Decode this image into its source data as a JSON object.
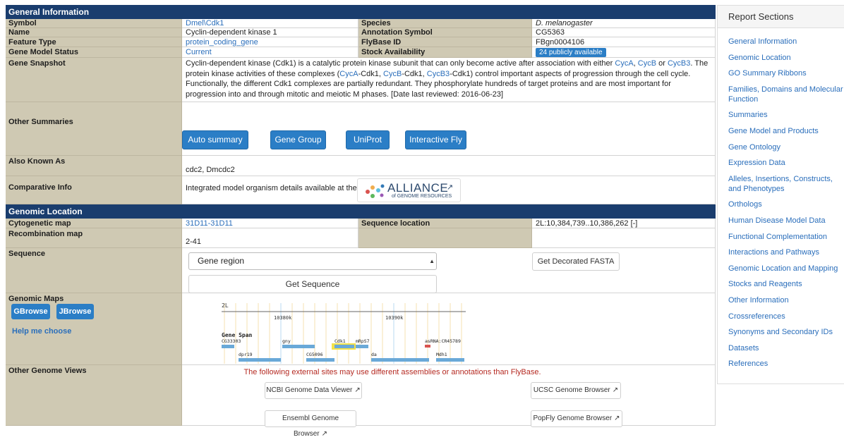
{
  "general": {
    "header": "General Information",
    "symbol_label": "Symbol",
    "symbol_value": "Dmel\\Cdk1",
    "species_label": "Species",
    "species_value": "D. melanogaster",
    "name_label": "Name",
    "name_value": "Cyclin-dependent kinase 1",
    "annot_label": "Annotation Symbol",
    "annot_value": "CG5363",
    "ftype_label": "Feature Type",
    "ftype_value": "protein_coding_gene",
    "fbid_label": "FlyBase ID",
    "fbid_value": "FBgn0004106",
    "gms_label": "Gene Model Status",
    "gms_value": "Current",
    "stock_label": "Stock Availability",
    "stock_badge": "24 publicly available",
    "snapshot_label": "Gene Snapshot",
    "snapshot": {
      "t1": "Cyclin-dependent kinase (Cdk1) is a catalytic protein kinase subunit that can only become active after association with either ",
      "l1": "CycA",
      "t2": ", ",
      "l2": "CycB",
      "t3": " or ",
      "l3": "CycB3",
      "t4": ". The protein kinase activities of these complexes (",
      "l4": "CycA",
      "t5": "-Cdk1, ",
      "l5": "CycB",
      "t6": "-Cdk1, ",
      "l6": "CycB3",
      "t7": "-Cdk1) control important aspects of progression through the cell cycle. Functionally, the different Cdk1 complexes are partially redundant. They phosphorylate hundreds of target proteins and are most important for progression into and through mitotic and meiotic M phases. [Date last reviewed: 2016-06-23]"
    },
    "other_label": "Other Summaries",
    "buttons": [
      "Auto summary",
      "Gene Group",
      "UniProt",
      "Interactive Fly"
    ],
    "aka_label": "Also Known As",
    "aka_value": "cdc2, Dmcdc2",
    "comp_label": "Comparative Info",
    "comp_text": "Integrated model organism details available at the",
    "alliance_name": "ALLIANCE",
    "alliance_sub": "of GENOME RESOURCES"
  },
  "genomic": {
    "header": "Genomic Location",
    "cyto_label": "Cytogenetic map",
    "cyto_value": "31D11-31D11",
    "seqloc_label": "Sequence location",
    "seqloc_value": "2L:10,384,739..10,386,262 [-]",
    "recomb_label": "Recombination map",
    "recomb_value": "2-41",
    "seq_label": "Sequence",
    "select_value": "Gene region",
    "fasta_button": "Get Decorated FASTA",
    "getseq_button": "Get Sequence",
    "maps_label": "Genomic Maps",
    "gbrowse": "GBrowse",
    "jbrowse": "JBrowse",
    "help": "Help me choose",
    "map": {
      "chrom": "2L",
      "tick1": "10380k",
      "tick2": "10390k",
      "track": "Gene Span",
      "genes": [
        "CG33303",
        "dpr19",
        "gny",
        "CG5096",
        "Cdk1",
        "mRpS7",
        "da",
        "asRNA:CR45789",
        "Mdh1"
      ]
    },
    "ogv_label": "Other Genome Views",
    "ogv_warning": "The following external sites may use different assemblies or annotations than FlyBase.",
    "ogv_buttons": [
      "NCBI Genome Data Viewer",
      "UCSC Genome Browser",
      "Ensembl Genome Browser",
      "PopFly Genome Browser"
    ]
  },
  "sidebar": {
    "title": "Report Sections",
    "items": [
      "General Information",
      "Genomic Location",
      "GO Summary Ribbons",
      "Families, Domains and Molecular Function",
      "Summaries",
      "Gene Model and Products",
      "Gene Ontology",
      "Expression Data",
      "Alleles, Insertions, Constructs, and Phenotypes",
      "Orthologs",
      "Human Disease Model Data",
      "Functional Complementation",
      "Interactions and Pathways",
      "Genomic Location and Mapping",
      "Stocks and Reagents",
      "Other Information",
      "Crossreferences",
      "Synonyms and Secondary IDs",
      "Datasets",
      "References"
    ]
  },
  "colors": {
    "header_bg": "#1a3d6e",
    "label_bg": "#cfc9b3",
    "link": "#2a6ebb",
    "button": "#2b7ec6",
    "warning": "#b52a22"
  },
  "icons": [
    "external-link-icon",
    "alliance-logo-icon",
    "dropdown-caret-icon"
  ]
}
